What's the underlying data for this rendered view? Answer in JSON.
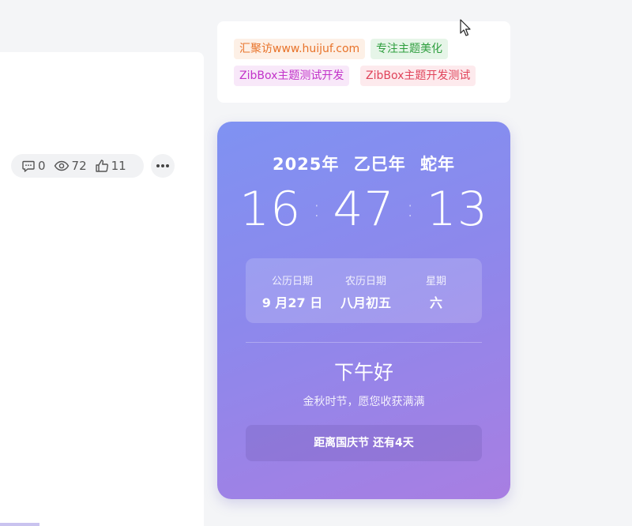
{
  "post_meta": {
    "comments": "0",
    "views": "72",
    "likes": "11"
  },
  "tags": [
    {
      "label": "汇聚访www.huijuf.com",
      "color": "#e8732a",
      "bg": "#fdf0e6"
    },
    {
      "label": "专注主题美化",
      "color": "#2e9e3e",
      "bg": "#e6f5e8"
    },
    {
      "label": "ZibBox主题测试开发",
      "color": "#c233c9",
      "bg": "#f8e8f9"
    },
    {
      "label": "ZibBox主题开发测试",
      "color": "#e0435a",
      "bg": "#fdeaed"
    }
  ],
  "calendar": {
    "year_line": "2025年  乙巳年  蛇年",
    "hour": "16",
    "minute": "47",
    "second": "13",
    "separator": ":",
    "solar_label": "公历日期",
    "solar_value": "9 月27 日",
    "lunar_label": "农历日期",
    "lunar_value": "八月初五",
    "week_label": "星期",
    "week_value": "六",
    "greeting": "下午好",
    "subtitle": "金秋时节，愿您收获满满",
    "countdown": "距离国庆节 还有4天"
  }
}
